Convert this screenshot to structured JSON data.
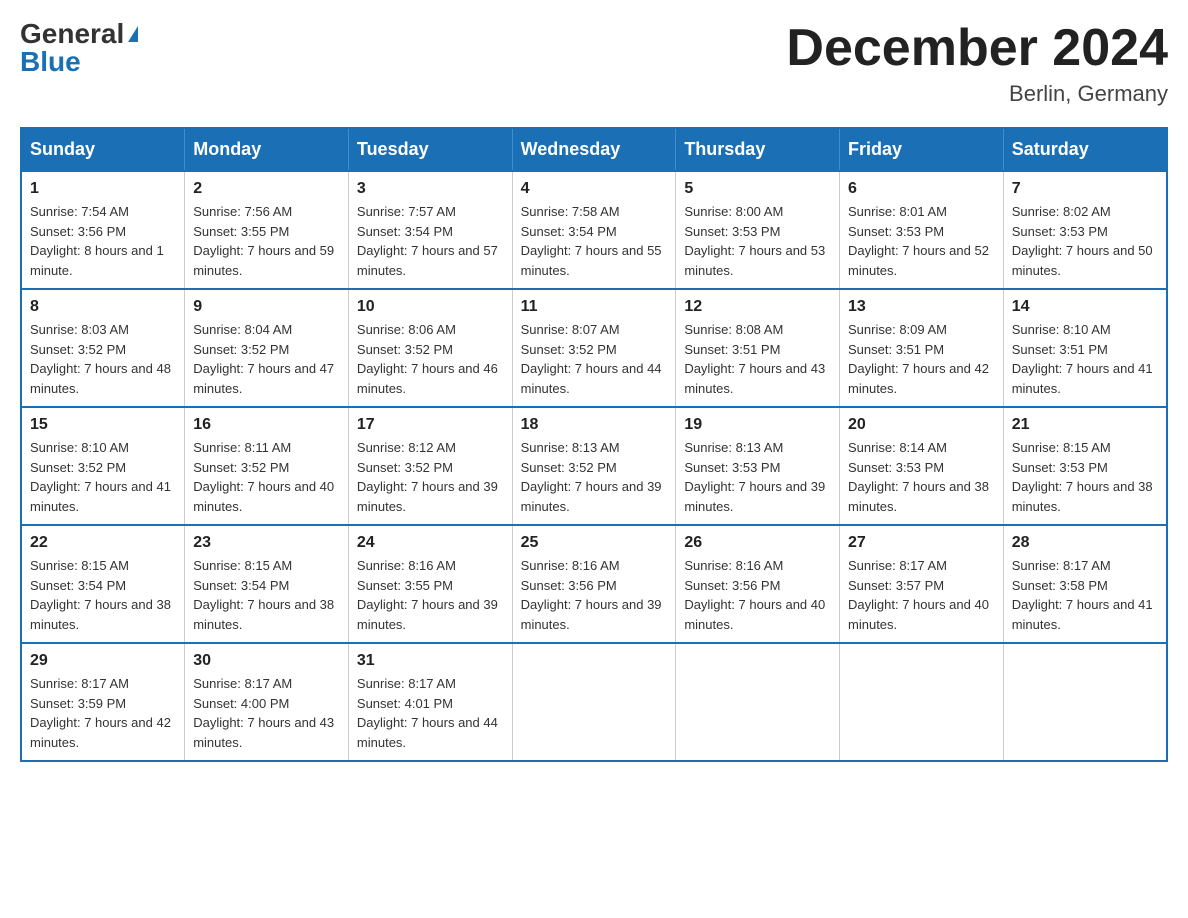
{
  "logo": {
    "general": "General",
    "blue": "Blue"
  },
  "header": {
    "month_title": "December 2024",
    "subtitle": "Berlin, Germany"
  },
  "weekdays": [
    "Sunday",
    "Monday",
    "Tuesday",
    "Wednesday",
    "Thursday",
    "Friday",
    "Saturday"
  ],
  "weeks": [
    [
      {
        "day": "1",
        "sunrise": "7:54 AM",
        "sunset": "3:56 PM",
        "daylight": "8 hours and 1 minute."
      },
      {
        "day": "2",
        "sunrise": "7:56 AM",
        "sunset": "3:55 PM",
        "daylight": "7 hours and 59 minutes."
      },
      {
        "day": "3",
        "sunrise": "7:57 AM",
        "sunset": "3:54 PM",
        "daylight": "7 hours and 57 minutes."
      },
      {
        "day": "4",
        "sunrise": "7:58 AM",
        "sunset": "3:54 PM",
        "daylight": "7 hours and 55 minutes."
      },
      {
        "day": "5",
        "sunrise": "8:00 AM",
        "sunset": "3:53 PM",
        "daylight": "7 hours and 53 minutes."
      },
      {
        "day": "6",
        "sunrise": "8:01 AM",
        "sunset": "3:53 PM",
        "daylight": "7 hours and 52 minutes."
      },
      {
        "day": "7",
        "sunrise": "8:02 AM",
        "sunset": "3:53 PM",
        "daylight": "7 hours and 50 minutes."
      }
    ],
    [
      {
        "day": "8",
        "sunrise": "8:03 AM",
        "sunset": "3:52 PM",
        "daylight": "7 hours and 48 minutes."
      },
      {
        "day": "9",
        "sunrise": "8:04 AM",
        "sunset": "3:52 PM",
        "daylight": "7 hours and 47 minutes."
      },
      {
        "day": "10",
        "sunrise": "8:06 AM",
        "sunset": "3:52 PM",
        "daylight": "7 hours and 46 minutes."
      },
      {
        "day": "11",
        "sunrise": "8:07 AM",
        "sunset": "3:52 PM",
        "daylight": "7 hours and 44 minutes."
      },
      {
        "day": "12",
        "sunrise": "8:08 AM",
        "sunset": "3:51 PM",
        "daylight": "7 hours and 43 minutes."
      },
      {
        "day": "13",
        "sunrise": "8:09 AM",
        "sunset": "3:51 PM",
        "daylight": "7 hours and 42 minutes."
      },
      {
        "day": "14",
        "sunrise": "8:10 AM",
        "sunset": "3:51 PM",
        "daylight": "7 hours and 41 minutes."
      }
    ],
    [
      {
        "day": "15",
        "sunrise": "8:10 AM",
        "sunset": "3:52 PM",
        "daylight": "7 hours and 41 minutes."
      },
      {
        "day": "16",
        "sunrise": "8:11 AM",
        "sunset": "3:52 PM",
        "daylight": "7 hours and 40 minutes."
      },
      {
        "day": "17",
        "sunrise": "8:12 AM",
        "sunset": "3:52 PM",
        "daylight": "7 hours and 39 minutes."
      },
      {
        "day": "18",
        "sunrise": "8:13 AM",
        "sunset": "3:52 PM",
        "daylight": "7 hours and 39 minutes."
      },
      {
        "day": "19",
        "sunrise": "8:13 AM",
        "sunset": "3:53 PM",
        "daylight": "7 hours and 39 minutes."
      },
      {
        "day": "20",
        "sunrise": "8:14 AM",
        "sunset": "3:53 PM",
        "daylight": "7 hours and 38 minutes."
      },
      {
        "day": "21",
        "sunrise": "8:15 AM",
        "sunset": "3:53 PM",
        "daylight": "7 hours and 38 minutes."
      }
    ],
    [
      {
        "day": "22",
        "sunrise": "8:15 AM",
        "sunset": "3:54 PM",
        "daylight": "7 hours and 38 minutes."
      },
      {
        "day": "23",
        "sunrise": "8:15 AM",
        "sunset": "3:54 PM",
        "daylight": "7 hours and 38 minutes."
      },
      {
        "day": "24",
        "sunrise": "8:16 AM",
        "sunset": "3:55 PM",
        "daylight": "7 hours and 39 minutes."
      },
      {
        "day": "25",
        "sunrise": "8:16 AM",
        "sunset": "3:56 PM",
        "daylight": "7 hours and 39 minutes."
      },
      {
        "day": "26",
        "sunrise": "8:16 AM",
        "sunset": "3:56 PM",
        "daylight": "7 hours and 40 minutes."
      },
      {
        "day": "27",
        "sunrise": "8:17 AM",
        "sunset": "3:57 PM",
        "daylight": "7 hours and 40 minutes."
      },
      {
        "day": "28",
        "sunrise": "8:17 AM",
        "sunset": "3:58 PM",
        "daylight": "7 hours and 41 minutes."
      }
    ],
    [
      {
        "day": "29",
        "sunrise": "8:17 AM",
        "sunset": "3:59 PM",
        "daylight": "7 hours and 42 minutes."
      },
      {
        "day": "30",
        "sunrise": "8:17 AM",
        "sunset": "4:00 PM",
        "daylight": "7 hours and 43 minutes."
      },
      {
        "day": "31",
        "sunrise": "8:17 AM",
        "sunset": "4:01 PM",
        "daylight": "7 hours and 44 minutes."
      },
      null,
      null,
      null,
      null
    ]
  ]
}
